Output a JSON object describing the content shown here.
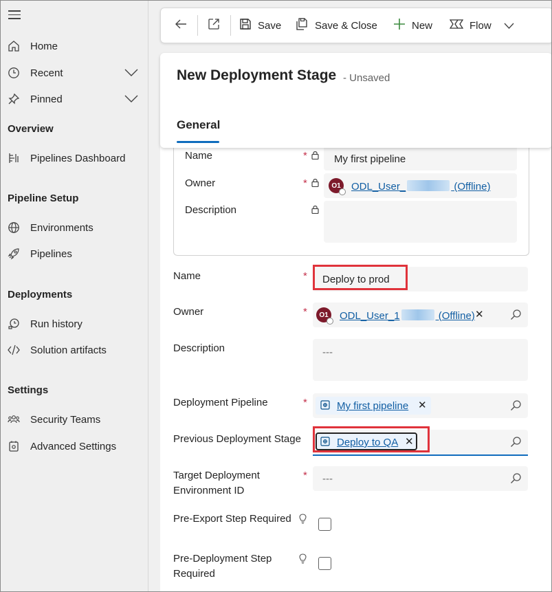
{
  "sidebar": {
    "items": [
      {
        "label": "Home",
        "icon": "home-icon"
      },
      {
        "label": "Recent",
        "icon": "clock-icon"
      },
      {
        "label": "Pinned",
        "icon": "pin-icon"
      },
      {
        "label": "Pipelines Dashboard",
        "icon": "dashboard-icon"
      },
      {
        "label": "Environments",
        "icon": "globe-icon"
      },
      {
        "label": "Pipelines",
        "icon": "rocket-icon"
      },
      {
        "label": "Run history",
        "icon": "history-icon"
      },
      {
        "label": "Solution artifacts",
        "icon": "code-icon"
      },
      {
        "label": "Security Teams",
        "icon": "team-icon"
      },
      {
        "label": "Advanced Settings",
        "icon": "settings-icon"
      }
    ],
    "sections": [
      "Overview",
      "Pipeline Setup",
      "Deployments",
      "Settings"
    ]
  },
  "toolbar": {
    "save": "Save",
    "save_close": "Save & Close",
    "new": "New",
    "flow": "Flow"
  },
  "header": {
    "title": "New Deployment Stage",
    "status": "- Unsaved",
    "tab": "General"
  },
  "quick_view": {
    "name_label": "Name",
    "name_value": "My first pipeline",
    "owner_label": "Owner",
    "owner_initials": "O1",
    "owner_prefix": "ODL_User_",
    "owner_suffix": " (Offline)",
    "description_label": "Description"
  },
  "form": {
    "name_label": "Name",
    "name_value": "Deploy to prod",
    "owner_label": "Owner",
    "owner_initials": "O1",
    "owner_prefix": "ODL_User_1",
    "owner_suffix": " (Offline)",
    "description_label": "Description",
    "description_placeholder": "---",
    "pipeline_label": "Deployment Pipeline",
    "pipeline_value": "My first pipeline",
    "previous_label": "Previous Deployment Stage",
    "previous_value": "Deploy to QA",
    "target_label_1": "Target Deployment",
    "target_label_2": "Environment ID",
    "target_placeholder": "---",
    "preexport_label": "Pre-Export Step Required",
    "predeploy_label_1": "Pre-Deployment Step",
    "predeploy_label_2": "Required",
    "required_mark": "*"
  },
  "colors": {
    "accent": "#0f6cbd",
    "highlight": "#e0333b",
    "required": "#c4314b",
    "avatar": "#7d1a2b"
  }
}
